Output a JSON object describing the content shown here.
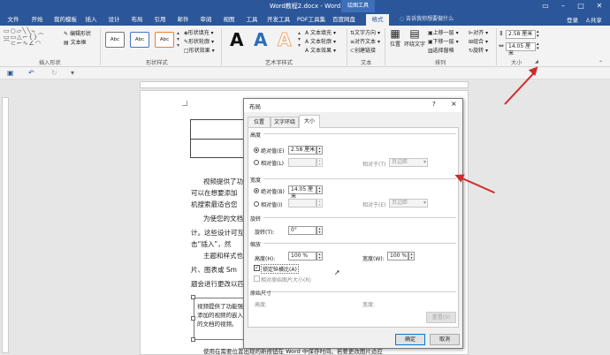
{
  "window": {
    "title": "Word教程2.docx - Word",
    "context_tab_group": "绘图工具",
    "login": "登录",
    "share": "共享"
  },
  "tabs": [
    "文件",
    "开始",
    "我的模板",
    "插入",
    "设计",
    "布局",
    "引用",
    "邮件",
    "审阅",
    "视图",
    "工具",
    "开发工具",
    "PDF工具集",
    "百度网盘",
    "格式"
  ],
  "active_tab": "格式",
  "tell_me": "告诉我你想要做什么",
  "ribbon": {
    "insert_shapes": {
      "edit_shape": "编辑形状",
      "textbox": "文本框",
      "label": "插入形状"
    },
    "shape_styles": {
      "styles": [
        "Abc",
        "Abc",
        "Abc"
      ],
      "fill": "形状填充",
      "outline": "形状轮廓",
      "effects": "形状效果",
      "label": "形状样式"
    },
    "wordart": {
      "letters": [
        "A",
        "A",
        "A"
      ],
      "letter_colors": [
        "#111111",
        "#2f6db5",
        "#f2a46c"
      ],
      "text_fill": "文本填充",
      "text_outline": "文本轮廓",
      "text_effects": "文本效果",
      "label": "艺术字样式"
    },
    "text": {
      "direction": "文字方向",
      "align": "对齐文本",
      "link": "创建链接",
      "label": "文本"
    },
    "arrange": {
      "position": "位置",
      "wrap": "环绕文字",
      "forward": "上移一层",
      "backward": "下移一层",
      "pane": "选择窗格",
      "align": "对齐",
      "group": "组合",
      "rotate": "旋转",
      "label": "排列"
    },
    "size": {
      "height": "2.58 厘米",
      "width": "14.05 厘米",
      "label": "大小"
    }
  },
  "document": {
    "lines": [
      "视频提供了功",
      "可以在想要添加",
      "机搜索最适合您",
      "为使您的文档",
      "计。这些设计可互",
      "击“插入”，然",
      "主题和样式也",
      "片、图表或 Sm",
      "题会进行更改以匹"
    ],
    "textbox_lines": [
      "视频提供了功能强",
      "添加的视频的嵌入",
      "的文档的视频。"
    ],
    "bottom_line": "使用在需要位置出现的新按钮在 Word 中保存时间。若要更改图片适应"
  },
  "dialog": {
    "title": "布局",
    "help": "?",
    "close": "×",
    "tabs": [
      "位置",
      "文字环绕",
      "大小"
    ],
    "active_tab": "大小",
    "height": {
      "section": "高度",
      "absolute": "绝对值(E)",
      "absolute_value": "2.58 厘米",
      "relative": "相对值(L)",
      "relative_to": "相对于(T)",
      "relative_to_value": "页边距"
    },
    "width": {
      "section": "宽度",
      "absolute": "绝对值(B)",
      "absolute_value": "14.05 厘米",
      "relative": "相对值(I)",
      "relative_to": "相对于(E)",
      "relative_to_value": "页边距"
    },
    "rotate": {
      "section": "旋转",
      "label": "旋转(T):",
      "value": "0°"
    },
    "scale": {
      "section": "缩放",
      "height": "高度(H):",
      "height_value": "100 %",
      "width": "宽度(W):",
      "width_value": "100 %",
      "lock_aspect": "锁定纵横比(A)",
      "relative_original": "相对原始图片大小(R)"
    },
    "original": {
      "section": "原始尺寸",
      "height": "高度:",
      "width": "宽度:",
      "reset": "重置(S)"
    },
    "ok": "确定",
    "cancel": "取消"
  },
  "colors": {
    "word_blue": "#2b579a",
    "arrow_red": "#d12a2a"
  }
}
